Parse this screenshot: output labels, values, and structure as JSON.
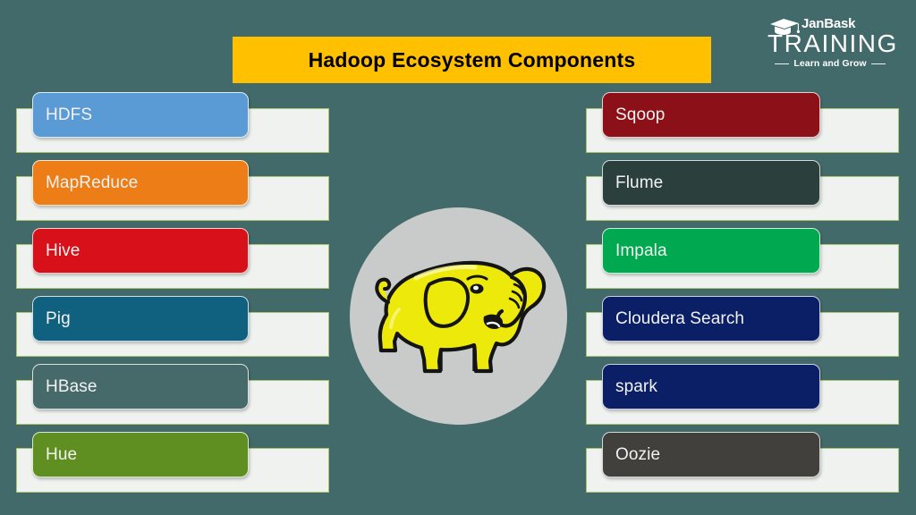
{
  "slide": {
    "background_color": "#436A6A",
    "title": "Hadoop Ecosystem Components",
    "title_banner_color": "#FFC000",
    "title_text_color": "#000000"
  },
  "logo": {
    "brand": "JanBask",
    "product": "TRAINING",
    "tagline": "Learn and Grow",
    "icon": "graduation-cap-icon",
    "color": "#FFFFFF"
  },
  "center_graphic": {
    "name": "hadoop-elephant-logo",
    "circle_color": "#C9CBCB",
    "elephant_color": "#EDE90A",
    "outline_color": "#1A1A1A"
  },
  "bar_style": {
    "fill": "#EFF2EF",
    "border": "#A9C46C"
  },
  "left_column": [
    {
      "label": "HDFS",
      "color": "#5B9BD5"
    },
    {
      "label": "MapReduce",
      "color": "#ED7D17"
    },
    {
      "label": "Hive",
      "color": "#D7101A"
    },
    {
      "label": "Pig",
      "color": "#106080"
    },
    {
      "label": "HBase",
      "color": "#46696A"
    },
    {
      "label": "Hue",
      "color": "#5F8F20"
    }
  ],
  "right_column": [
    {
      "label": "Sqoop",
      "color": "#8C1018"
    },
    {
      "label": "Flume",
      "color": "#2B3F3D"
    },
    {
      "label": "Impala",
      "color": "#00A94F"
    },
    {
      "label": "Cloudera  Search",
      "color": "#0B1F66"
    },
    {
      "label": "spark",
      "color": "#0B1F66"
    },
    {
      "label": "Oozie",
      "color": "#42403D"
    }
  ]
}
